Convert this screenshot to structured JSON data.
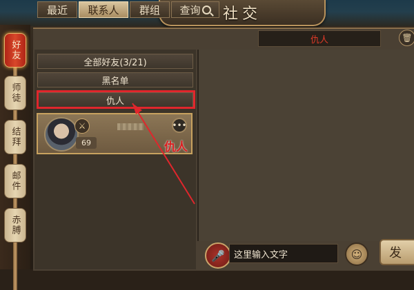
{
  "title": "社交",
  "side_tabs": [
    {
      "label": "好友",
      "active": true
    },
    {
      "label": "师徒",
      "active": false
    },
    {
      "label": "结拜",
      "active": false
    },
    {
      "label": "邮件",
      "active": false
    },
    {
      "label": "赤膊",
      "active": false
    }
  ],
  "top_tabs": [
    {
      "label": "最近"
    },
    {
      "label": "联系人"
    },
    {
      "label": "群组"
    },
    {
      "label": "查询"
    }
  ],
  "friend_groups": {
    "all_friends": "全部好友(3/21)",
    "blacklist": "黑名单",
    "enemies": "仇人"
  },
  "contact": {
    "level": "69",
    "more_label": "•••",
    "enemy_annotation": "仇人"
  },
  "chat": {
    "header": "仇人",
    "input_placeholder": "这里输入文字",
    "send_label": "发"
  },
  "colors": {
    "highlight_red": "#e0262c",
    "enemy_red": "#d81f1f",
    "active_tab_red": "#c03a22",
    "frame_gold": "#c8a25f"
  },
  "icons": {
    "search": "search-icon",
    "trash": "trash-icon",
    "mic": "microphone-icon",
    "emoji": "emoji-icon",
    "more": "more-icon",
    "class_badge": "weapon-badge-icon"
  }
}
